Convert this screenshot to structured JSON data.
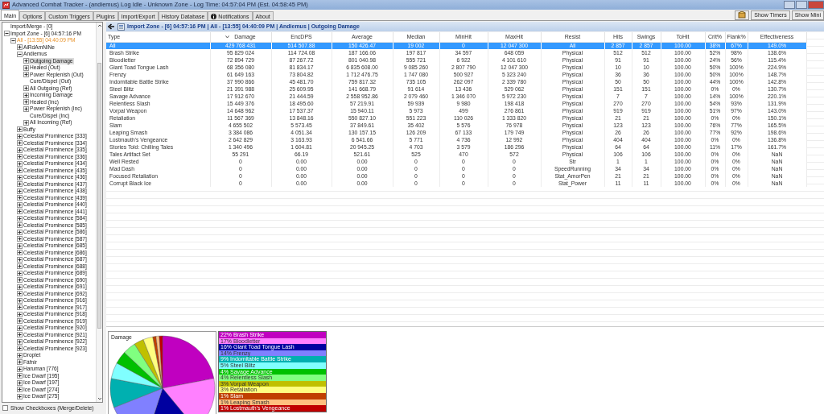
{
  "window": {
    "title": "Advanced Combat Tracker - (andiemus) Log Idle - Unknown Zone - Log Time: 04:57:04 PM (Est. 04:58:45 PM)"
  },
  "tabs": [
    {
      "label": "Main",
      "selected": true
    },
    {
      "label": "Options",
      "selected": false
    },
    {
      "label": "Custom Triggers",
      "selected": false
    },
    {
      "label": "Plugins",
      "selected": false
    },
    {
      "label": "Import/Export",
      "selected": false
    },
    {
      "label": "History Database",
      "selected": false
    },
    {
      "label": "Notifications",
      "selected": false,
      "kind": "info"
    },
    {
      "label": "About",
      "selected": false
    }
  ],
  "toolbar_buttons": [
    "Show Timers",
    "Show Mini"
  ],
  "tree": [
    {
      "label": "Import/Merge - [0]",
      "kind": "leaf",
      "selected": false
    },
    {
      "label": "Import Zone - [6] 04:57:16 PM",
      "kind": "group",
      "expanded": true,
      "selected": false,
      "children": [
        {
          "label": "All - [13:55] 04:40:09 PM",
          "kind": "encounter",
          "expanded": true,
          "selected": false,
          "children": [
            {
              "label": "AiRdAmNiNe",
              "kind": "group",
              "expanded": false,
              "selected": false
            },
            {
              "label": "Andiemus",
              "kind": "group",
              "expanded": true,
              "selected": false,
              "children": [
                {
                  "label": "Outgoing Damage",
                  "kind": "group",
                  "expanded": false,
                  "selected": true
                },
                {
                  "label": "Healed (Out)",
                  "kind": "group",
                  "expanded": false,
                  "selected": false
                },
                {
                  "label": "Power Replenish (Out)",
                  "kind": "group",
                  "expanded": false,
                  "selected": false
                },
                {
                  "label": "Cure/Dispel (Out)",
                  "kind": "leaf",
                  "selected": false
                },
                {
                  "label": "All Outgoing (Ref)",
                  "kind": "group",
                  "expanded": false,
                  "selected": false
                },
                {
                  "label": "Incoming Damage",
                  "kind": "group",
                  "expanded": false,
                  "selected": false
                },
                {
                  "label": "Healed (Inc)",
                  "kind": "group",
                  "expanded": false,
                  "selected": false
                },
                {
                  "label": "Power Replenish (Inc)",
                  "kind": "group",
                  "expanded": false,
                  "selected": false
                },
                {
                  "label": "Cure/Dispel (Inc)",
                  "kind": "leaf",
                  "selected": false
                },
                {
                  "label": "All Incoming (Ref)",
                  "kind": "group",
                  "expanded": false,
                  "selected": false
                }
              ]
            },
            {
              "label": "Buffy",
              "kind": "group",
              "expanded": false,
              "selected": false
            },
            {
              "label": "Celestial Prominence [333]",
              "kind": "group",
              "expanded": false,
              "selected": false
            },
            {
              "label": "Celestial Prominence [334]",
              "kind": "group",
              "expanded": false,
              "selected": false
            },
            {
              "label": "Celestial Prominence [335]",
              "kind": "group",
              "expanded": false,
              "selected": false
            },
            {
              "label": "Celestial Prominence [336]",
              "kind": "group",
              "expanded": false,
              "selected": false
            },
            {
              "label": "Celestial Prominence [434]",
              "kind": "group",
              "expanded": false,
              "selected": false
            },
            {
              "label": "Celestial Prominence [435]",
              "kind": "group",
              "expanded": false,
              "selected": false
            },
            {
              "label": "Celestial Prominence [436]",
              "kind": "group",
              "expanded": false,
              "selected": false
            },
            {
              "label": "Celestial Prominence [437]",
              "kind": "group",
              "expanded": false,
              "selected": false
            },
            {
              "label": "Celestial Prominence [438]",
              "kind": "group",
              "expanded": false,
              "selected": false
            },
            {
              "label": "Celestial Prominence [439]",
              "kind": "group",
              "expanded": false,
              "selected": false
            },
            {
              "label": "Celestial Prominence [440]",
              "kind": "group",
              "expanded": false,
              "selected": false
            },
            {
              "label": "Celestial Prominence [441]",
              "kind": "group",
              "expanded": false,
              "selected": false
            },
            {
              "label": "Celestial Prominence [584]",
              "kind": "group",
              "expanded": false,
              "selected": false
            },
            {
              "label": "Celestial Prominence [585]",
              "kind": "group",
              "expanded": false,
              "selected": false
            },
            {
              "label": "Celestial Prominence [586]",
              "kind": "group",
              "expanded": false,
              "selected": false
            },
            {
              "label": "Celestial Prominence [587]",
              "kind": "group",
              "expanded": false,
              "selected": false
            },
            {
              "label": "Celestial Prominence [685]",
              "kind": "group",
              "expanded": false,
              "selected": false
            },
            {
              "label": "Celestial Prominence [686]",
              "kind": "group",
              "expanded": false,
              "selected": false
            },
            {
              "label": "Celestial Prominence [687]",
              "kind": "group",
              "expanded": false,
              "selected": false
            },
            {
              "label": "Celestial Prominence [688]",
              "kind": "group",
              "expanded": false,
              "selected": false
            },
            {
              "label": "Celestial Prominence [689]",
              "kind": "group",
              "expanded": false,
              "selected": false
            },
            {
              "label": "Celestial Prominence [690]",
              "kind": "group",
              "expanded": false,
              "selected": false
            },
            {
              "label": "Celestial Prominence [691]",
              "kind": "group",
              "expanded": false,
              "selected": false
            },
            {
              "label": "Celestial Prominence [692]",
              "kind": "group",
              "expanded": false,
              "selected": false
            },
            {
              "label": "Celestial Prominence [916]",
              "kind": "group",
              "expanded": false,
              "selected": false
            },
            {
              "label": "Celestial Prominence [917]",
              "kind": "group",
              "expanded": false,
              "selected": false
            },
            {
              "label": "Celestial Prominence [918]",
              "kind": "group",
              "expanded": false,
              "selected": false
            },
            {
              "label": "Celestial Prominence [919]",
              "kind": "group",
              "expanded": false,
              "selected": false
            },
            {
              "label": "Celestial Prominence [920]",
              "kind": "group",
              "expanded": false,
              "selected": false
            },
            {
              "label": "Celestial Prominence [921]",
              "kind": "group",
              "expanded": false,
              "selected": false
            },
            {
              "label": "Celestial Prominence [922]",
              "kind": "group",
              "expanded": false,
              "selected": false
            },
            {
              "label": "Celestial Prominence [923]",
              "kind": "group",
              "expanded": false,
              "selected": false
            },
            {
              "label": "Droplet",
              "kind": "group",
              "expanded": false,
              "selected": false
            },
            {
              "label": "Fáfnir",
              "kind": "group",
              "expanded": false,
              "selected": false
            },
            {
              "label": "Haruman [776]",
              "kind": "group",
              "expanded": false,
              "selected": false
            },
            {
              "label": "Ice Dwarf [195]",
              "kind": "group",
              "expanded": false,
              "selected": false
            },
            {
              "label": "Ice Dwarf [197]",
              "kind": "group",
              "expanded": false,
              "selected": false
            },
            {
              "label": "Ice Dwarf [274]",
              "kind": "group",
              "expanded": false,
              "selected": false
            },
            {
              "label": "Ice Dwarf [275]",
              "kind": "group",
              "expanded": false,
              "selected": false
            }
          ]
        }
      ]
    }
  ],
  "show_checkboxes": {
    "label": "Show Checkboxes (Merge/Delete)",
    "checked": false
  },
  "breadcrumb": "Import Zone - [6] 04:57:16 PM | All - [13:55] 04:40:09 PM | Andiemus | Outgoing Damage",
  "table": {
    "columns": [
      {
        "label": "Type",
        "sorted": false
      },
      {
        "label": "Damage",
        "sorted": true
      },
      {
        "label": "EncDPS",
        "sorted": false
      },
      {
        "label": "Average",
        "sorted": false
      },
      {
        "label": "Median",
        "sorted": false
      },
      {
        "label": "MinHit",
        "sorted": false
      },
      {
        "label": "MaxHit",
        "sorted": false
      },
      {
        "label": "Resist",
        "sorted": false
      },
      {
        "label": "Hits",
        "sorted": false
      },
      {
        "label": "Swings",
        "sorted": false
      },
      {
        "label": "ToHit",
        "sorted": false
      },
      {
        "label": "Crit%",
        "sorted": false
      },
      {
        "label": "Flank%",
        "sorted": false
      },
      {
        "label": "Effectiveness",
        "sorted": false
      }
    ],
    "rows": [
      {
        "selected": true,
        "cells": [
          "All",
          "429 768 431",
          "514 507.88",
          "150 426.47",
          "19 002",
          "0",
          "12 047 300",
          "All",
          "2 857",
          "2 857",
          "100.00",
          "38%",
          "67%",
          "149.0%"
        ]
      },
      {
        "selected": false,
        "cells": [
          "Brash Strike",
          "95 829 024",
          "114 724.08",
          "187 166.06",
          "197 817",
          "34 597",
          "648 059",
          "Physical",
          "512",
          "512",
          "100.00",
          "52%",
          "98%",
          "138.6%"
        ]
      },
      {
        "selected": false,
        "cells": [
          "Bloodletter",
          "72 894 729",
          "87 267.72",
          "801 040.98",
          "555 721",
          "6 922",
          "4 101 610",
          "Physical",
          "91",
          "91",
          "100.00",
          "24%",
          "56%",
          "115.4%"
        ]
      },
      {
        "selected": false,
        "cells": [
          "Giant Toad Tongue Lash",
          "68 356 080",
          "81 834.17",
          "6 835 608.00",
          "9 085 260",
          "2 807 790",
          "12 047 300",
          "Physical",
          "10",
          "10",
          "100.00",
          "50%",
          "100%",
          "224.9%"
        ]
      },
      {
        "selected": false,
        "cells": [
          "Frenzy",
          "61 649 163",
          "73 804.82",
          "1 712 476.75",
          "1 747 080",
          "500 927",
          "5 323 240",
          "Physical",
          "36",
          "36",
          "100.00",
          "50%",
          "100%",
          "148.7%"
        ]
      },
      {
        "selected": false,
        "cells": [
          "Indomitable Battle Strike",
          "37 990 866",
          "45 481.70",
          "759 817.32",
          "735 105",
          "262 097",
          "2 339 780",
          "Physical",
          "50",
          "50",
          "100.00",
          "44%",
          "100%",
          "142.8%"
        ]
      },
      {
        "selected": false,
        "cells": [
          "Steel Blitz",
          "21 391 988",
          "25 609.95",
          "141 668.79",
          "91 614",
          "13 436",
          "529 062",
          "Physical",
          "151",
          "151",
          "100.00",
          "0%",
          "0%",
          "130.7%"
        ]
      },
      {
        "selected": false,
        "cells": [
          "Savage Advance",
          "17 912 670",
          "21 444.59",
          "2 558 952.86",
          "2 079 460",
          "1 346 070",
          "5 972 230",
          "Physical",
          "7",
          "7",
          "100.00",
          "14%",
          "100%",
          "220.1%"
        ]
      },
      {
        "selected": false,
        "cells": [
          "Relentless Slash",
          "15 449 376",
          "18 495.60",
          "57 219.91",
          "59 939",
          "9 980",
          "198 418",
          "Physical",
          "270",
          "270",
          "100.00",
          "54%",
          "93%",
          "131.9%"
        ]
      },
      {
        "selected": false,
        "cells": [
          "Vorpal Weapon",
          "14 648 962",
          "17 537.37",
          "15 940.11",
          "5 973",
          "499",
          "276 861",
          "Physical",
          "919",
          "919",
          "100.00",
          "51%",
          "97%",
          "143.0%"
        ]
      },
      {
        "selected": false,
        "cells": [
          "Retaliation",
          "11 567 369",
          "13 848.16",
          "550 827.10",
          "551 223",
          "110 026",
          "1 333 820",
          "Physical",
          "21",
          "21",
          "100.00",
          "0%",
          "0%",
          "150.1%"
        ]
      },
      {
        "selected": false,
        "cells": [
          "Slam",
          "4 655 502",
          "5 573.45",
          "37 849.61",
          "35 402",
          "5 576",
          "76 978",
          "Physical",
          "123",
          "123",
          "100.00",
          "76%",
          "77%",
          "165.5%"
        ]
      },
      {
        "selected": false,
        "cells": [
          "Leaping Smash",
          "3 384 086",
          "4 051.34",
          "130 157.15",
          "126 209",
          "67 133",
          "179 749",
          "Physical",
          "26",
          "26",
          "100.00",
          "77%",
          "92%",
          "198.6%"
        ]
      },
      {
        "selected": false,
        "cells": [
          "Lostmauth's Vengeance",
          "2 642 829",
          "3 163.93",
          "6 541.66",
          "5 771",
          "4 736",
          "12 992",
          "Physical",
          "404",
          "404",
          "100.00",
          "0%",
          "0%",
          "136.8%"
        ]
      },
      {
        "selected": false,
        "cells": [
          "Stories Told: Chilling Tales",
          "1 340 496",
          "1 604.81",
          "20 945.25",
          "4 703",
          "3 579",
          "186 296",
          "Physical",
          "64",
          "64",
          "100.00",
          "11%",
          "17%",
          "161.7%"
        ]
      },
      {
        "selected": false,
        "cells": [
          "Tales Artifact Set",
          "55 291",
          "66.19",
          "521.61",
          "525",
          "470",
          "572",
          "Physical",
          "106",
          "106",
          "100.00",
          "0%",
          "0%",
          "NaN"
        ]
      },
      {
        "selected": false,
        "cells": [
          "Well Rested",
          "0",
          "0.00",
          "0.00",
          "0",
          "0",
          "0",
          "Str",
          "1",
          "1",
          "100.00",
          "0%",
          "0%",
          "NaN"
        ]
      },
      {
        "selected": false,
        "cells": [
          "Mad Dash",
          "0",
          "0.00",
          "0.00",
          "0",
          "0",
          "0",
          "SpeedRunning",
          "34",
          "34",
          "100.00",
          "0%",
          "0%",
          "NaN"
        ]
      },
      {
        "selected": false,
        "cells": [
          "Focused Retaliation",
          "0",
          "0.00",
          "0.00",
          "0",
          "0",
          "0",
          "Stat_AmorPen",
          "21",
          "21",
          "100.00",
          "0%",
          "0%",
          "NaN"
        ]
      },
      {
        "selected": false,
        "cells": [
          "Corrupt Black Ice",
          "0",
          "0.00",
          "0.00",
          "0",
          "0",
          "0",
          "Stat_Power",
          "11",
          "11",
          "100.00",
          "0%",
          "0%",
          "NaN"
        ]
      }
    ]
  },
  "pie": {
    "chart_data": {
      "type": "pie",
      "title": "Damage",
      "categories": [
        "Brash Strike",
        "Bloodletter",
        "Giant Toad Tongue Lash",
        "Frenzy",
        "Indomitable Battle Strike",
        "Steel Blitz",
        "Savage Advance",
        "Relentless Slash",
        "Vorpal Weapon",
        "Retaliation",
        "Slam",
        "Leaping Smash",
        "Lostmauth's Vengeance"
      ],
      "values": [
        22,
        17,
        16,
        14,
        9,
        5,
        4,
        4,
        3,
        3,
        1,
        1,
        1
      ],
      "value_labels": [
        "22%",
        "17%",
        "16%",
        "14%",
        "9%",
        "5%",
        "4%",
        "4%",
        "3%",
        "3%",
        "1%",
        "1%",
        "1%"
      ],
      "colors": [
        "#c000c0",
        "#ff80ff",
        "#0000a0",
        "#8080ff",
        "#00b0b0",
        "#80ffff",
        "#00c000",
        "#80ff80",
        "#c0c000",
        "#ffff80",
        "#c04000",
        "#ffc080",
        "#c00000"
      ]
    }
  }
}
